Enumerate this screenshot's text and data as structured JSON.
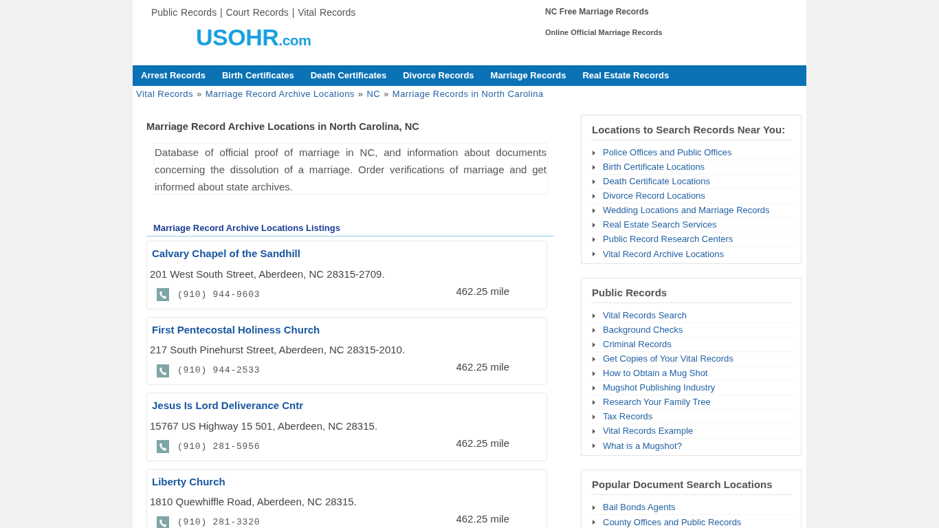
{
  "header": {
    "tagline": "Public Records | Court Records | Vital Records",
    "logo": {
      "name": "USOHR",
      "suffix": ".com"
    },
    "links": [
      "NC Free Marriage Records",
      "Online Official Marriage Records"
    ]
  },
  "nav": [
    "Arrest Records",
    "Birth Certificates",
    "Death Certificates",
    "Divorce Records",
    "Marriage Records",
    "Real Estate Records"
  ],
  "breadcrumb": [
    {
      "label": "Vital Records",
      "separator": "»"
    },
    {
      "label": "Marriage Record Archive Locations",
      "separator": "»"
    },
    {
      "label": "NC",
      "separator": "»"
    },
    {
      "label": "Marriage Records in North Carolina"
    }
  ],
  "main": {
    "title": "Marriage Record Archive Locations in North Carolina, NC",
    "description": "Database of official proof of marriage in NC, and information about documents concerning the dissolution of a marriage. Order verifications of marriage and get informed about state archives.",
    "listings_heading": "Marriage Record Archive Locations Listings",
    "listings": [
      {
        "name": "Calvary Chapel of the Sandhill",
        "address": "201 West South Street, Aberdeen, NC 28315-2709.",
        "phone": "(910) 944-9603",
        "distance": "462.25 mile"
      },
      {
        "name": "First Pentecostal Holiness Church",
        "address": "217 South Pinehurst Street, Aberdeen, NC 28315-2010.",
        "phone": "(910) 944-2533",
        "distance": "462.25 mile"
      },
      {
        "name": "Jesus Is Lord Deliverance Cntr",
        "address": "15767 US Highway 15 501, Aberdeen, NC 28315.",
        "phone": "(910) 281-5956",
        "distance": "462.25 mile"
      },
      {
        "name": "Liberty Church",
        "address": "1810 Quewhiffle Road, Aberdeen, NC 28315.",
        "phone": "(910) 281-3320",
        "distance": "462.25 mile"
      }
    ]
  },
  "sidebar": [
    {
      "title": "Locations to Search Records Near You:",
      "links": [
        "Police Offices and Public Offices",
        "Birth Certificate Locations",
        "Death Certificate Locations",
        "Divorce Record Locations",
        "Wedding Locations and Marriage Records",
        "Real Estate Search Services",
        "Public Record Research Centers",
        "Vital Record Archive Locations"
      ]
    },
    {
      "title": "Public Records",
      "links": [
        "Vital Records Search",
        "Background Checks",
        "Criminal Records",
        "Get Copies of Your Vital Records",
        "How to Obtain a Mug Shot",
        "Mugshot Publishing Industry",
        "Research Your Family Tree",
        "Tax Records",
        "Vital Records Example",
        "What is a Mugshot?"
      ]
    },
    {
      "title": "Popular Document Search Locations",
      "links": [
        "Bail Bonds Agents",
        "County Offices and Public Records"
      ]
    }
  ]
}
